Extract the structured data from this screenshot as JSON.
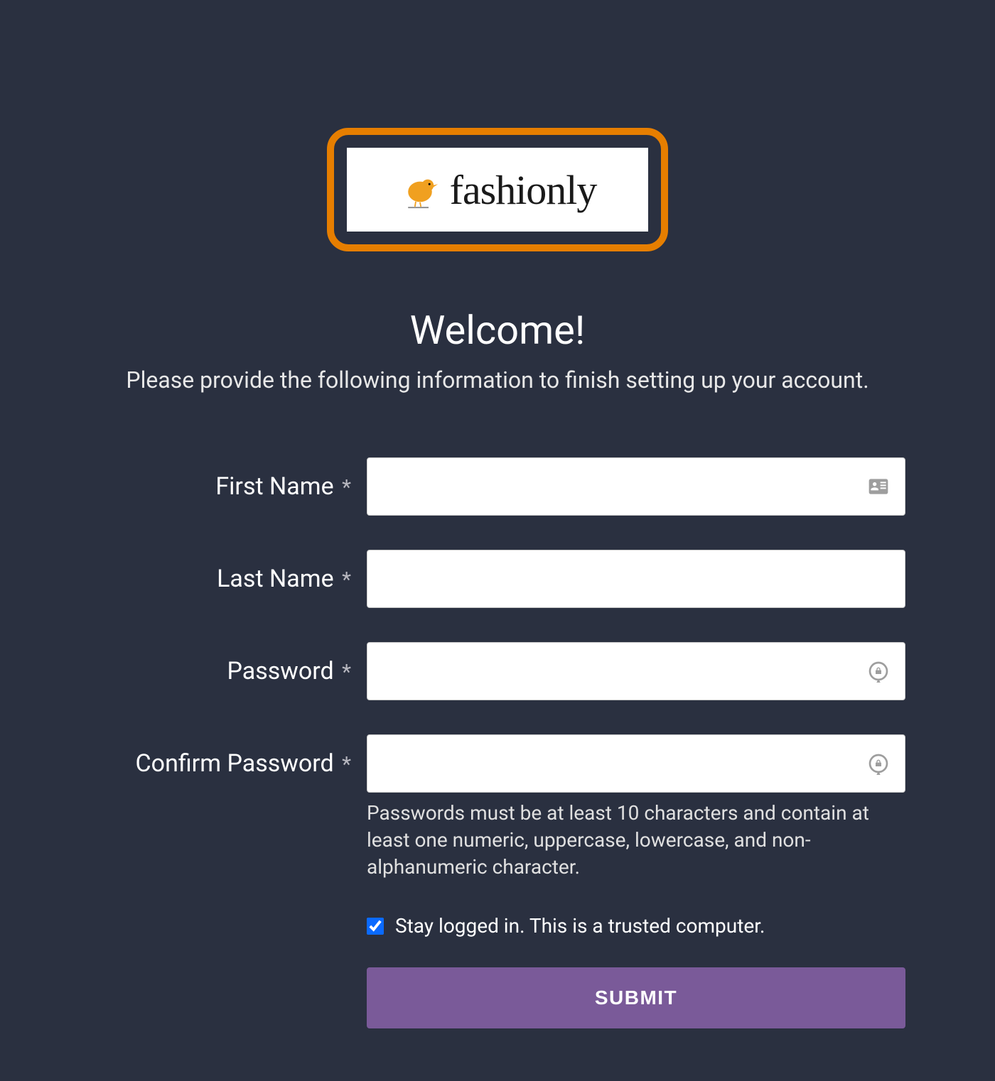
{
  "brand": {
    "name": "fashionly"
  },
  "header": {
    "title": "Welcome!",
    "subtitle": "Please provide the following information to finish setting up your account."
  },
  "form": {
    "first_name": {
      "label": "First Name",
      "value": ""
    },
    "last_name": {
      "label": "Last Name",
      "value": ""
    },
    "password": {
      "label": "Password",
      "value": ""
    },
    "confirm_password": {
      "label": "Confirm Password",
      "value": ""
    },
    "password_hint": "Passwords must be at least 10 characters and contain at least one numeric, uppercase, lowercase, and non-alphanumeric character.",
    "stay_logged_in": {
      "label": "Stay logged in. This is a trusted computer.",
      "checked": true
    },
    "submit_label": "SUBMIT",
    "required_mark": "*"
  }
}
